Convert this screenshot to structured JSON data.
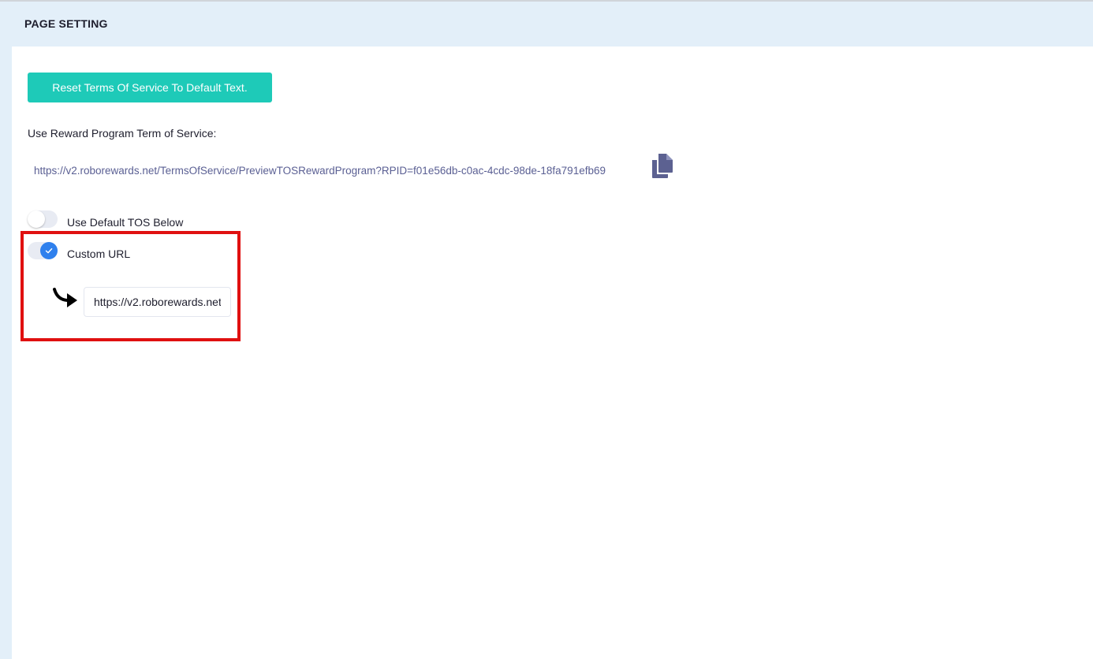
{
  "header": {
    "title": "PAGE SETTING"
  },
  "actions": {
    "reset_label": "Reset Terms Of Service To Default Text."
  },
  "tos": {
    "label": "Use Reward Program Term of Service:",
    "link": "https://v2.roborewards.net/TermsOfService/PreviewTOSRewardProgram?RPID=f01e56db-c0ac-4cdc-98de-18fa791efb69",
    "copy_icon": "copy-icon"
  },
  "options": {
    "default_tos": {
      "label": "Use Default TOS Below",
      "checked": false
    },
    "custom_url": {
      "label": "Custom URL",
      "checked": true,
      "value": "https://v2.roborewards.net"
    }
  },
  "annotation": {
    "arrow_icon": "curved-arrow-right-icon",
    "highlight_color": "#e01010"
  },
  "colors": {
    "accent": "#1ecab8",
    "toggle_on": "#2f80ed",
    "link": "#5a5f93",
    "header_bg": "#e3eff9"
  }
}
